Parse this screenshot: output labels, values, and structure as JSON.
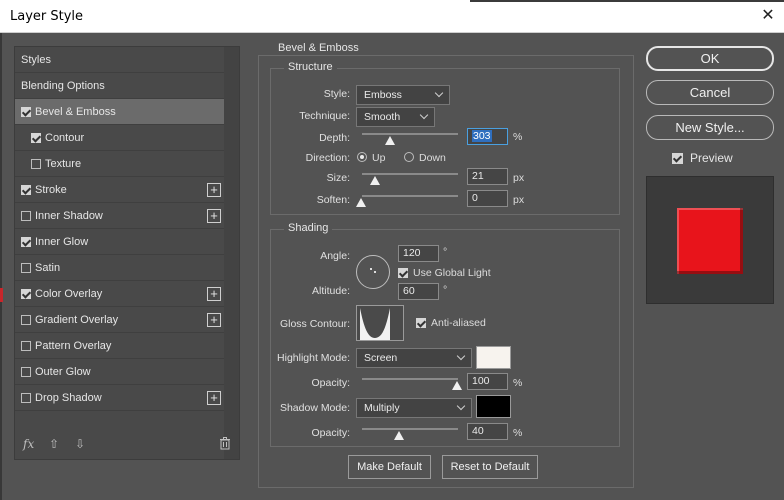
{
  "window": {
    "title": "Layer Style",
    "close_glyph": "✕"
  },
  "styles_panel": {
    "items": [
      {
        "label": "Styles",
        "checkbox": false,
        "checked": false,
        "plus": false,
        "indent": false,
        "selected": false
      },
      {
        "label": "Blending Options",
        "checkbox": false,
        "checked": false,
        "plus": false,
        "indent": false,
        "selected": false
      },
      {
        "label": "Bevel & Emboss",
        "checkbox": true,
        "checked": true,
        "plus": false,
        "indent": false,
        "selected": true
      },
      {
        "label": "Contour",
        "checkbox": true,
        "checked": true,
        "plus": false,
        "indent": true,
        "selected": false
      },
      {
        "label": "Texture",
        "checkbox": true,
        "checked": false,
        "plus": false,
        "indent": true,
        "selected": false
      },
      {
        "label": "Stroke",
        "checkbox": true,
        "checked": true,
        "plus": true,
        "indent": false,
        "selected": false
      },
      {
        "label": "Inner Shadow",
        "checkbox": true,
        "checked": false,
        "plus": true,
        "indent": false,
        "selected": false
      },
      {
        "label": "Inner Glow",
        "checkbox": true,
        "checked": true,
        "plus": false,
        "indent": false,
        "selected": false
      },
      {
        "label": "Satin",
        "checkbox": true,
        "checked": false,
        "plus": false,
        "indent": false,
        "selected": false
      },
      {
        "label": "Color Overlay",
        "checkbox": true,
        "checked": true,
        "plus": true,
        "indent": false,
        "selected": false
      },
      {
        "label": "Gradient Overlay",
        "checkbox": true,
        "checked": false,
        "plus": true,
        "indent": false,
        "selected": false
      },
      {
        "label": "Pattern Overlay",
        "checkbox": true,
        "checked": false,
        "plus": false,
        "indent": false,
        "selected": false
      },
      {
        "label": "Outer Glow",
        "checkbox": true,
        "checked": false,
        "plus": false,
        "indent": false,
        "selected": false
      },
      {
        "label": "Drop Shadow",
        "checkbox": true,
        "checked": false,
        "plus": true,
        "indent": false,
        "selected": false
      }
    ],
    "tools": {
      "fx": "fx",
      "up": "⇧",
      "down": "⇩",
      "trash": "🗑"
    }
  },
  "bevel_emboss": {
    "section_title": "Bevel & Emboss",
    "structure": {
      "title": "Structure",
      "style_label": "Style:",
      "style_value": "Emboss",
      "technique_label": "Technique:",
      "technique_value": "Smooth",
      "depth_label": "Depth:",
      "depth_value": "303",
      "depth_unit": "%",
      "direction_label": "Direction:",
      "direction_up": "Up",
      "direction_down": "Down",
      "direction_selected": "Up",
      "size_label": "Size:",
      "size_value": "21",
      "size_unit": "px",
      "soften_label": "Soften:",
      "soften_value": "0",
      "soften_unit": "px"
    },
    "shading": {
      "title": "Shading",
      "angle_label": "Angle:",
      "angle_value": "120",
      "angle_unit": "°",
      "use_global_light": "Use Global Light",
      "altitude_label": "Altitude:",
      "altitude_value": "60",
      "altitude_unit": "°",
      "gloss_contour_label": "Gloss Contour:",
      "anti_aliased": "Anti-aliased",
      "highlight_mode_label": "Highlight Mode:",
      "highlight_mode_value": "Screen",
      "highlight_color": "#f7f3ee",
      "highlight_opacity_label": "Opacity:",
      "highlight_opacity_value": "100",
      "highlight_opacity_unit": "%",
      "shadow_mode_label": "Shadow Mode:",
      "shadow_mode_value": "Multiply",
      "shadow_color": "#000000",
      "shadow_opacity_label": "Opacity:",
      "shadow_opacity_value": "40",
      "shadow_opacity_unit": "%"
    },
    "make_default": "Make Default",
    "reset_to_default": "Reset to Default"
  },
  "actions": {
    "ok": "OK",
    "cancel": "Cancel",
    "new_style": "New Style...",
    "preview": "Preview",
    "preview_checked": true,
    "preview_color": "#e8141b"
  }
}
